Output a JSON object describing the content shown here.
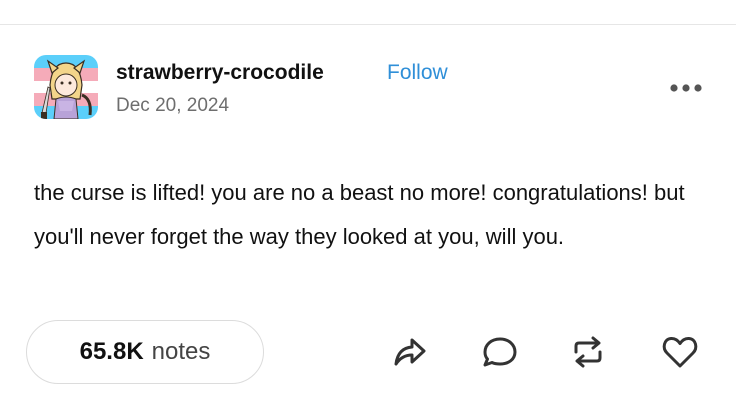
{
  "post": {
    "username": "strawberry-crocodile",
    "follow_label": "Follow",
    "date": "Dec 20, 2024",
    "body": "the curse is lifted! you are no a beast no more! congratulations! but you'll never forget the way they looked at you, will you."
  },
  "footer": {
    "notes_count": "65.8K",
    "notes_label": "notes",
    "actions": [
      "share-icon",
      "reply-icon",
      "reblog-icon",
      "like-icon"
    ]
  },
  "icons": {
    "more": "more-dots-icon"
  },
  "colors": {
    "follow": "#2f8fd8",
    "text": "#111111",
    "muted": "#6e6e6e",
    "border": "#dcdcdc"
  }
}
